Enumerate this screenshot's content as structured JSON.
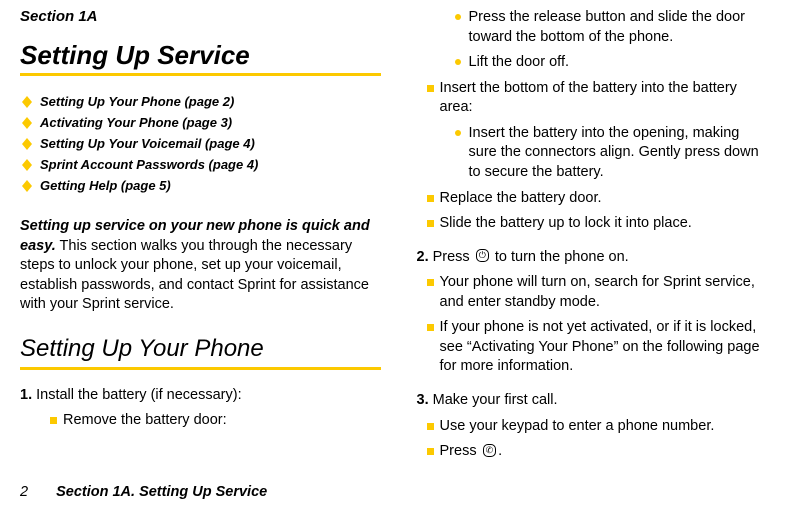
{
  "section_label": "Section 1A",
  "main_title": "Setting Up Service",
  "toc": [
    "Setting Up Your Phone (page 2)",
    "Activating Your Phone (page 3)",
    "Setting Up Your Voicemail (page 4)",
    "Sprint Account Passwords (page 4)",
    "Getting Help (page 5)"
  ],
  "intro_bold": "Setting up service on your new phone is quick and easy.",
  "intro_rest": " This section walks you through the necessary steps to unlock your phone, set up your voicemail, establish passwords, and contact Sprint for assistance with your Sprint service.",
  "h2": "Setting Up Your Phone",
  "step1_num": "1.",
  "step1_text": " Install the battery (if necessary):",
  "step1_sub1": "Remove the battery door:",
  "col2": {
    "bullet1": "Press the release button and slide the door toward the bottom of the phone.",
    "bullet2": "Lift the door off.",
    "sub2": "Insert the bottom of the battery into the battery area:",
    "bullet3": "Insert the battery into the opening, making sure the connectors align. Gently press down to secure the battery.",
    "sub3": "Replace the battery door.",
    "sub4": "Slide the battery up to lock it into place."
  },
  "step2_num": "2.",
  "step2_text_a": " Press ",
  "step2_icon": "⏻",
  "step2_text_b": " to turn the phone on.",
  "step2_sub1": "Your phone will turn on, search for Sprint service, and enter standby mode.",
  "step2_sub2": "If your phone is not yet activated, or if it is locked, see “Activating Your Phone” on the following page for more information.",
  "step3_num": "3.",
  "step3_text": " Make your first call.",
  "step3_sub1": "Use your keypad to enter a phone number.",
  "step3_sub2a": "Press ",
  "step3_icon": "✆",
  "step3_sub2b": ".",
  "footer_page": "2",
  "footer_text": "Section 1A. Setting Up Service"
}
